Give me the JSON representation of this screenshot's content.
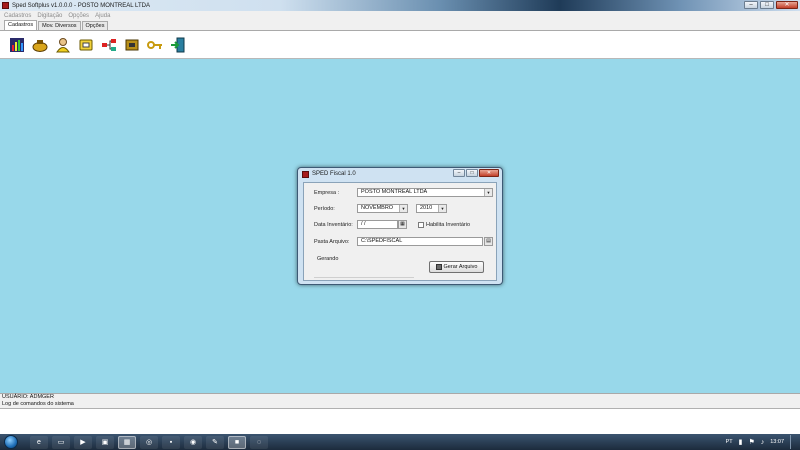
{
  "window": {
    "title": "Sped Softplus v1.0.0.0 - POSTO MONTREAL LTDA",
    "buttons": {
      "minimize": "–",
      "maximize": "□",
      "close": "✕"
    }
  },
  "menu": {
    "items": [
      "Cadastros",
      "Digitação",
      "Opções",
      "Ajuda"
    ]
  },
  "tabs": [
    {
      "label": "Cadastros"
    },
    {
      "label": "Mov. Diversos"
    },
    {
      "label": "Opções"
    }
  ],
  "toolbar": {
    "icons": [
      "chart-icon",
      "bag-icon",
      "user-icon",
      "folder-icon",
      "network-icon",
      "box-icon",
      "keys-icon",
      "exit-icon"
    ]
  },
  "dialog": {
    "title": "SPED Fiscal 1.0",
    "labels": {
      "empresa": "Empresa :",
      "periodo": "Período:",
      "data_inventario": "Data Inventário:",
      "pasta_arquivo": "Pasta Arquivo:",
      "habilita_inventario": "Habilita Inventário",
      "status": "Gerando"
    },
    "values": {
      "empresa": "POSTO MONTREAL LTDA",
      "mes": "NOVEMBRO",
      "ano": "2010",
      "data_inventario": " / /",
      "pasta_arquivo": "C:\\SPEDFISCAL"
    },
    "buttons": {
      "gerar": "Gerar Arquivo"
    }
  },
  "footer": {
    "user": "USUÁRIO: ADMGER",
    "log_caption": "Log de comandos do sistema"
  },
  "taskbar": {
    "tray_lang": "PT",
    "time": "13:07"
  },
  "colors": {
    "workspace": "#98d8ea",
    "dialog_frame": "#cfe2f2"
  }
}
